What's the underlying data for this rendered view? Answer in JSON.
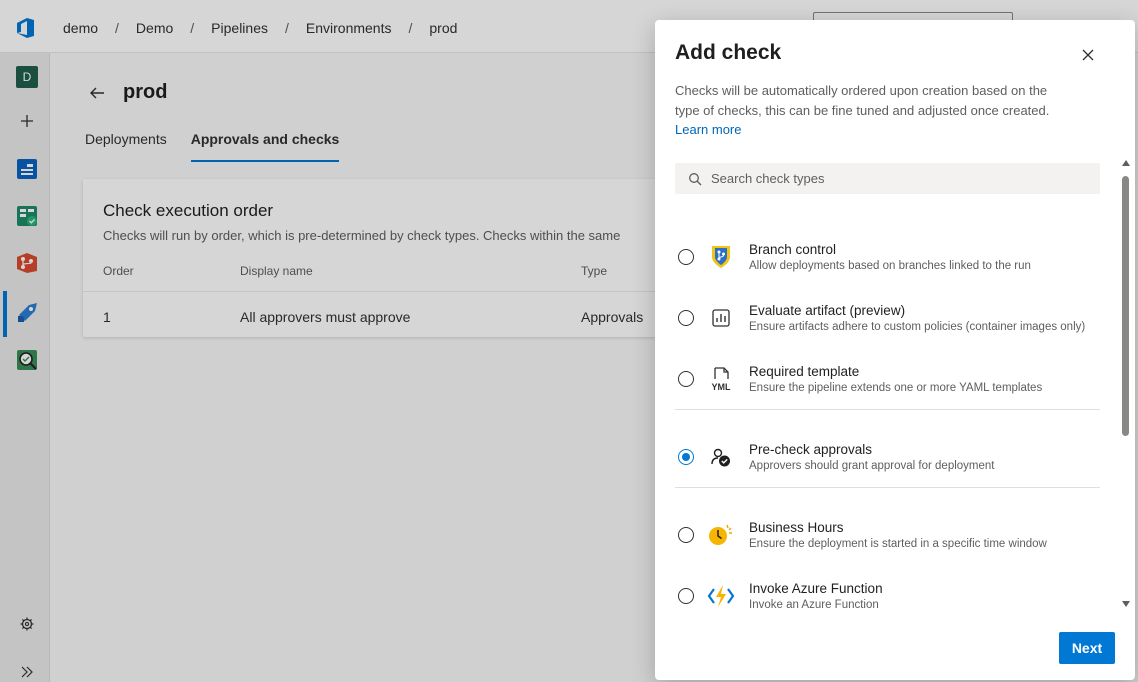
{
  "breadcrumb": [
    "demo",
    "Demo",
    "Pipelines",
    "Environments",
    "prod"
  ],
  "leftnav": {
    "project_initial": "D",
    "items": [
      "plus-icon",
      "boards-icon",
      "plans-icon",
      "repos-icon",
      "pipelines-icon",
      "test-plans-icon"
    ],
    "bottom": [
      "settings-icon",
      "expand-icon"
    ]
  },
  "page": {
    "title": "prod",
    "tabs": [
      {
        "label": "Deployments",
        "active": false
      },
      {
        "label": "Approvals and checks",
        "active": true
      }
    ],
    "card": {
      "title": "Check execution order",
      "subtitle": "Checks will run by order, which is pre-determined by check types. Checks within the same",
      "columns": [
        "Order",
        "Display name",
        "Type"
      ],
      "rows": [
        {
          "order": "1",
          "name": "All approvers must approve",
          "type": "Approvals"
        }
      ]
    }
  },
  "panel": {
    "title": "Add check",
    "description": "Checks will be automatically ordered upon creation based on the type of checks, this can be fine tuned and adjusted once created.",
    "learn_more": "Learn more",
    "search_placeholder": "Search check types",
    "items": [
      {
        "name": "Branch control",
        "desc": "Allow deployments based on branches linked to the run",
        "icon": "branch-control-icon",
        "selected": false
      },
      {
        "name": "Evaluate artifact (preview)",
        "desc": "Ensure artifacts adhere to custom policies (container images only)",
        "icon": "evaluate-artifact-icon",
        "selected": false
      },
      {
        "name": "Required template",
        "desc": "Ensure the pipeline extends one or more YAML templates",
        "icon": "yaml-template-icon",
        "selected": false
      },
      {
        "name": "Pre-check approvals",
        "desc": "Approvers should grant approval for deployment",
        "icon": "approval-icon",
        "selected": true
      },
      {
        "name": "Business Hours",
        "desc": "Ensure the deployment is started in a specific time window",
        "icon": "business-hours-icon",
        "selected": false
      },
      {
        "name": "Invoke Azure Function",
        "desc": "Invoke an Azure Function",
        "icon": "azure-function-icon",
        "selected": false
      }
    ],
    "yaml_icon_text": "YML",
    "next_label": "Next"
  },
  "colors": {
    "accent": "#0078d4",
    "link": "#0067b8"
  }
}
